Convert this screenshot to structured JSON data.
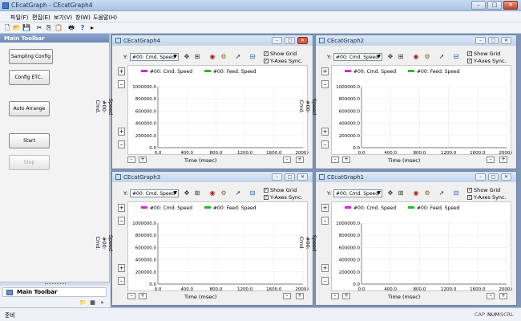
{
  "app": {
    "title": "CEcatGraph - CEcatGraph4",
    "menu": [
      "파일(F)",
      "편집(E)",
      "보기(V)",
      "창(W)",
      "도움말(H)"
    ]
  },
  "window_controls": {
    "minimize": "–",
    "maximize": "□",
    "close": "✕"
  },
  "toolbar": {
    "icons": [
      "new-file-icon",
      "open-folder-icon",
      "save-icon",
      "cut-icon",
      "copy-icon",
      "paste-icon",
      "print-icon",
      "help-icon",
      "more-icon"
    ],
    "glyphs": [
      "🗋",
      "📂",
      "💾",
      "✂",
      "⎘",
      "📋",
      "🖶",
      "?",
      "▸"
    ]
  },
  "left_panel": {
    "title": "Main Toolbar",
    "buttons": [
      {
        "label": "Sampling Config",
        "enabled": true
      },
      {
        "label": "Config ETC..",
        "enabled": true
      },
      {
        "label": "Auto Arrange",
        "enabled": true
      },
      {
        "label": "Start",
        "enabled": true
      },
      {
        "label": "Stop",
        "enabled": false
      }
    ],
    "bottom_tab": "Main Toolbar",
    "bottom_icons": [
      "folder-icon",
      "grid-icon",
      "chevron-icon"
    ],
    "bottom_glyphs": [
      "📁",
      "▦",
      "»"
    ]
  },
  "graph_common": {
    "y_prefix": "Y:",
    "y_select": "#00: Cmd. Speed",
    "legend": [
      {
        "name": "#00: Cmd. Speed",
        "color": "#e020e0"
      },
      {
        "name": "#00: Feed. Speed",
        "color": "#20c020"
      }
    ],
    "checkboxes": [
      {
        "label": "Show Grid",
        "checked": true
      },
      {
        "label": "Y-Axes Sync.",
        "checked": true
      }
    ],
    "check_glyph": "✓",
    "ylabel_lines": [
      "Cmd.",
      "#00:",
      "Speed"
    ],
    "xlabel": "Time (msec)",
    "y_ticks": [
      "1000000.0",
      "800000.0",
      "600000.0",
      "400000.0",
      "200000.0",
      "0.0"
    ],
    "x_ticks": [
      "0.0",
      "400.0",
      "800.0",
      "1200.0",
      "1600.0",
      "2000.0"
    ],
    "side_buttons": [
      "+",
      "–",
      "+",
      "–"
    ],
    "bottom_buttons": [
      "–",
      "+",
      "–",
      "+"
    ],
    "tool_icons": [
      "move-icon",
      "zoom-fit-icon",
      "record-icon",
      "cursor-settings-icon",
      "pointer-icon",
      "axis-config-icon"
    ],
    "tool_glyphs": [
      "✥",
      "⊞",
      "◉",
      "⚙",
      "➚",
      "⊟"
    ]
  },
  "chart_data": [
    {
      "type": "line",
      "title": "CEcatGraph4",
      "xlabel": "Time (msec)",
      "ylabel": "#00: Cmd. Speed",
      "xlim": [
        0,
        2000
      ],
      "ylim": [
        0,
        1000000
      ],
      "grid": true,
      "series": [
        {
          "name": "#00: Cmd. Speed",
          "values": []
        },
        {
          "name": "#00: Feed. Speed",
          "values": []
        }
      ]
    },
    {
      "type": "line",
      "title": "CEcatGraph2",
      "xlabel": "Time (msec)",
      "ylabel": "#00: Cmd. Speed",
      "xlim": [
        0,
        2000
      ],
      "ylim": [
        0,
        1000000
      ],
      "grid": true,
      "series": [
        {
          "name": "#00: Cmd. Speed",
          "values": []
        },
        {
          "name": "#00: Feed. Speed",
          "values": []
        }
      ]
    },
    {
      "type": "line",
      "title": "CEcatGraph3",
      "xlabel": "Time (msec)",
      "ylabel": "#00: Cmd. Speed",
      "xlim": [
        0,
        2000
      ],
      "ylim": [
        0,
        1000000
      ],
      "grid": true,
      "series": [
        {
          "name": "#00: Cmd. Speed",
          "values": []
        },
        {
          "name": "#00: Feed. Speed",
          "values": []
        }
      ]
    },
    {
      "type": "line",
      "title": "CEcatGraph1",
      "xlabel": "Time (msec)",
      "ylabel": "#00: Cmd. Speed",
      "xlim": [
        0,
        2000
      ],
      "ylim": [
        0,
        1000000
      ],
      "grid": true,
      "series": [
        {
          "name": "#00: Cmd. Speed",
          "values": []
        },
        {
          "name": "#00: Feed. Speed",
          "values": []
        }
      ]
    }
  ],
  "status": {
    "ready": "준비",
    "indicators": [
      "CAP",
      "NUM",
      "SCRL"
    ]
  }
}
